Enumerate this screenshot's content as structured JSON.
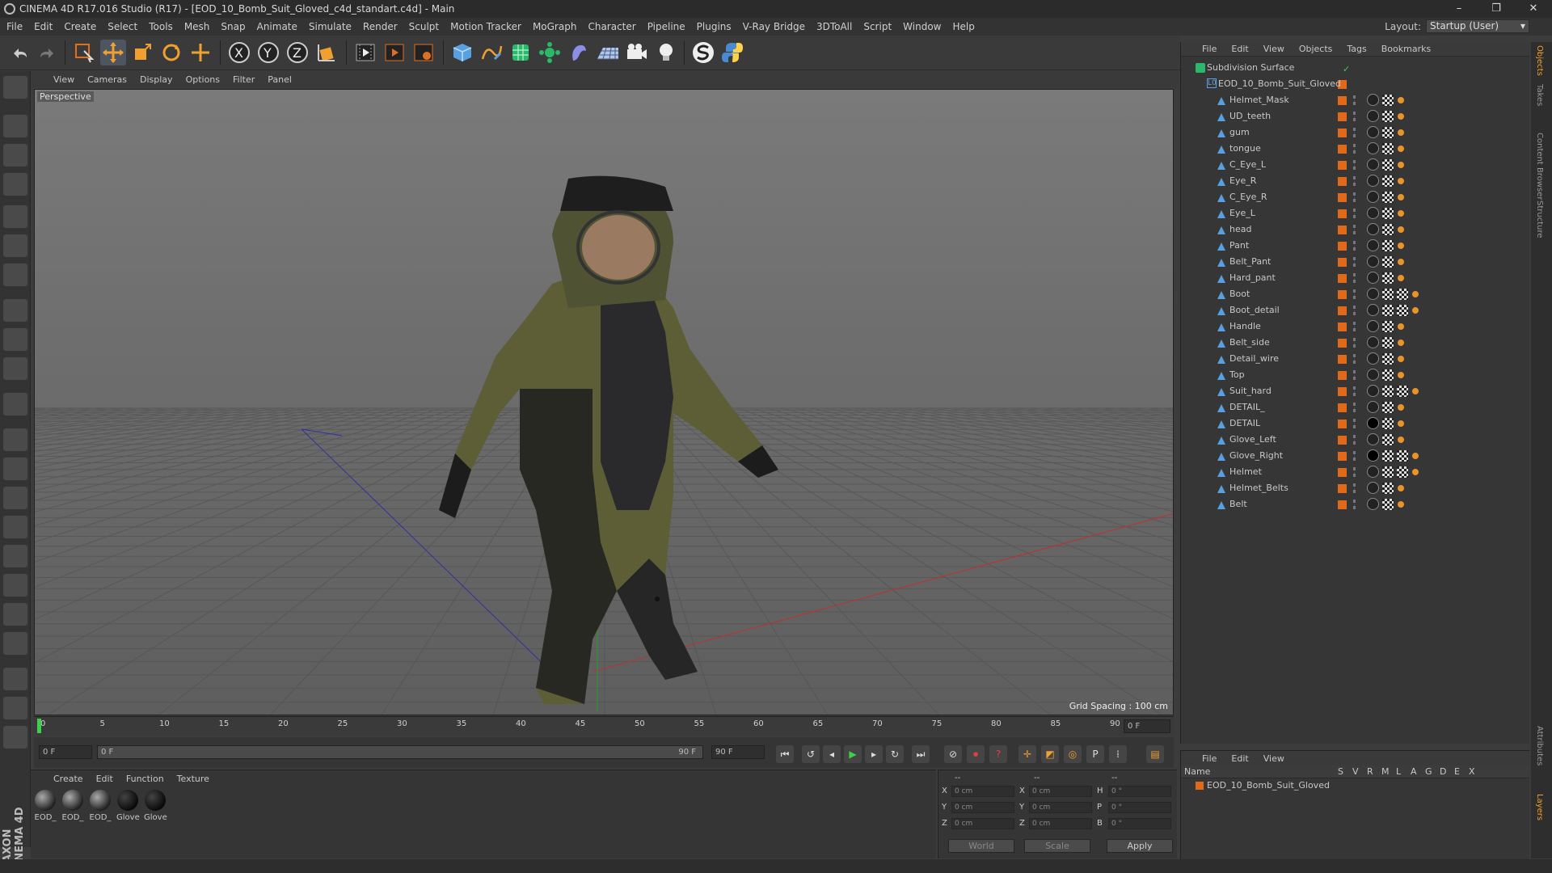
{
  "window": {
    "title": "CINEMA 4D R17.016 Studio (R17) - [EOD_10_Bomb_Suit_Gloved_c4d_standart.c4d] - Main",
    "controls": [
      "–",
      "❐",
      "✕"
    ]
  },
  "menubar": [
    "File",
    "Edit",
    "Create",
    "Select",
    "Tools",
    "Mesh",
    "Snap",
    "Animate",
    "Simulate",
    "Render",
    "Sculpt",
    "Motion Tracker",
    "MoGraph",
    "Character",
    "Pipeline",
    "Plugins",
    "V-Ray Bridge",
    "3DToAll",
    "Script",
    "Window",
    "Help"
  ],
  "layout": {
    "label": "Layout:",
    "value": "Startup (User)"
  },
  "viewport": {
    "menu": [
      "View",
      "Cameras",
      "Display",
      "Options",
      "Filter",
      "Panel"
    ],
    "label": "Perspective",
    "grid_spacing": "Grid Spacing : 100 cm"
  },
  "timeline": {
    "ticks": [
      "0",
      "5",
      "10",
      "15",
      "20",
      "25",
      "30",
      "35",
      "40",
      "45",
      "50",
      "55",
      "60",
      "65",
      "70",
      "75",
      "80",
      "85",
      "90"
    ],
    "current_frame": "0 F",
    "start_field": "0 F",
    "range_start": "0 F",
    "range_end": "90 F",
    "end_field": "90 F"
  },
  "materials": {
    "menu": [
      "Create",
      "Edit",
      "Function",
      "Texture"
    ],
    "items": [
      "EOD_",
      "EOD_",
      "EOD_",
      "Glove",
      "Glove"
    ]
  },
  "coords": {
    "headers": [
      "--",
      "--",
      "--"
    ],
    "rows": [
      {
        "a": "X",
        "av": "0 cm",
        "b": "X",
        "bv": "0 cm",
        "c": "H",
        "cv": "0 °"
      },
      {
        "a": "Y",
        "av": "0 cm",
        "b": "Y",
        "bv": "0 cm",
        "c": "P",
        "cv": "0 °"
      },
      {
        "a": "Z",
        "av": "0 cm",
        "b": "Z",
        "bv": "0 cm",
        "c": "B",
        "cv": "0 °"
      }
    ],
    "mode1": "World",
    "mode2": "Scale",
    "apply": "Apply"
  },
  "objects": {
    "menu": [
      "File",
      "Edit",
      "View",
      "Objects",
      "Tags",
      "Bookmarks"
    ],
    "root": "Subdivision Surface",
    "group": "EOD_10_Bomb_Suit_Gloved",
    "items": [
      "Helmet_Mask",
      "UD_teeth",
      "gum",
      "tongue",
      "C_Eye_L",
      "Eye_R",
      "C_Eye_R",
      "Eye_L",
      "head",
      "Pant",
      "Belt_Pant",
      "Hard_pant",
      "Boot",
      "Boot_detail",
      "Handle",
      "Belt_side",
      "Detail_wire",
      "Top",
      "Suit_hard",
      "DETAIL_",
      "DETAIL",
      "Glove_Left",
      "Glove_Right",
      "Helmet",
      "Helmet_Belts",
      "Belt"
    ]
  },
  "layers": {
    "menu": [
      "File",
      "Edit",
      "View"
    ],
    "header_name": "Name",
    "header_cols": [
      "S",
      "V",
      "R",
      "M",
      "L",
      "A",
      "G",
      "D",
      "E",
      "X"
    ],
    "row": "EOD_10_Bomb_Suit_Gloved"
  },
  "side_tabs": [
    "Objects",
    "Takes",
    "Content Browser",
    "Structure",
    "Attributes",
    "Layers"
  ],
  "brand": "MAXON CINEMA 4D",
  "colors": {
    "layer_orange": "#e06a1a",
    "accent_blue": "#4a90d0"
  }
}
